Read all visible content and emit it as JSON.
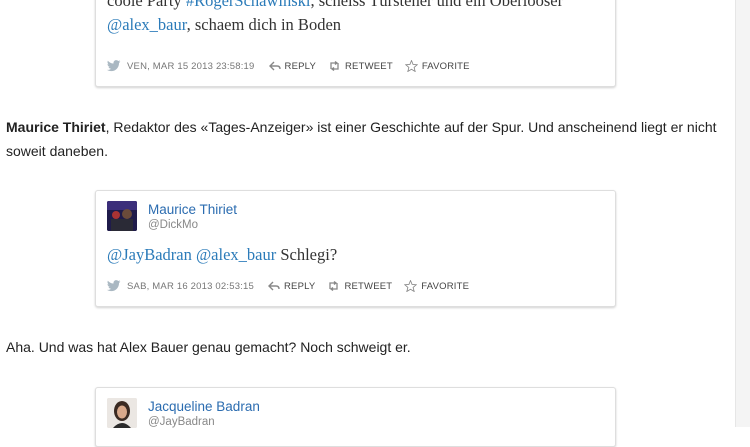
{
  "tweets": [
    {
      "text_prefix": "coole Party ",
      "hashtag": "#RogerSchawinski",
      "text_mid": ", scheiss Türsteher und ein Oberlooser",
      "mention": "@alex_baur",
      "text_suffix": ", schaem dich in Boden",
      "timestamp": "VEN, MAR 15 2013 23:58:19",
      "reply_label": "REPLY",
      "retweet_label": "RETWEET",
      "favorite_label": "FAVORITE"
    },
    {
      "author_name": "Maurice Thiriet",
      "author_handle": "@DickMo",
      "mention1": "@JayBadran",
      "mention2": "@alex_baur",
      "text_suffix": " Schlegi?",
      "timestamp": "SAB, MAR 16 2013 02:53:15",
      "reply_label": "REPLY",
      "retweet_label": "RETWEET",
      "favorite_label": "FAVORITE"
    },
    {
      "author_name": "Jacqueline Badran",
      "author_handle": "@JayBadran"
    }
  ],
  "paragraphs": [
    {
      "bold": "Maurice Thiriet",
      "text": ", Redaktor des «Tages-Anzeiger» ist einer Geschichte auf der Spur. Und anscheinend liegt er nicht soweit daneben."
    },
    {
      "text": "Aha. Und was hat Alex Bauer genau gemacht? Noch schweigt er."
    }
  ],
  "colors": {
    "link": "#2b7bb9",
    "author": "#2b6cb0",
    "meta": "#777777"
  }
}
